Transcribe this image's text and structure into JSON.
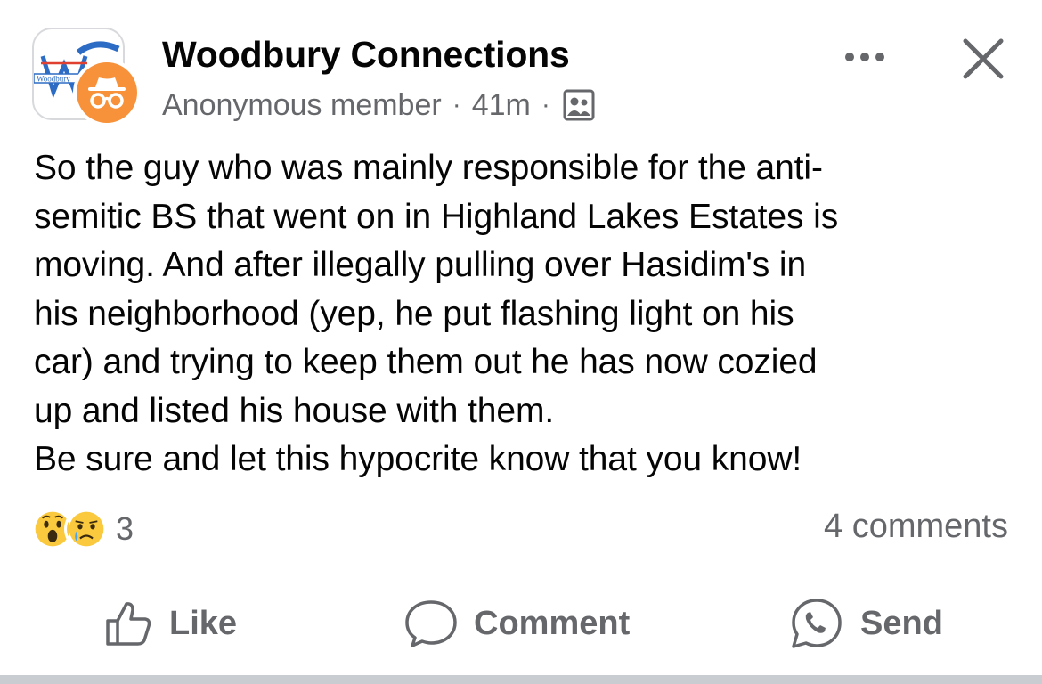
{
  "post": {
    "group_name": "Woodbury Connections",
    "group_logo_text": "Woodbury",
    "author": "Anonymous member",
    "separator": "·",
    "time": "41m",
    "audience_icon": "group-audience-icon",
    "body": "So the guy who was mainly responsible for the anti-\nsemitic BS that went on in Highland Lakes Estates is\nmoving. And after illegally pulling over Hasidim's in\nhis neighborhood (yep, he put flashing light on his\ncar) and trying to keep them out he has now cozied\nup and listed his house with them.\nBe sure and let this hypocrite know that you know!",
    "reactions": {
      "icons": [
        "wow-reaction-icon",
        "sad-reaction-icon"
      ],
      "count": "3"
    },
    "comments_count": "4 comments"
  },
  "actions": {
    "like": "Like",
    "comment": "Comment",
    "send": "Send"
  },
  "colors": {
    "text": "#050505",
    "secondary": "#65676b",
    "anon_badge": "#f7923a",
    "reaction_yellow": "#fbc93d",
    "divider": "#c9ccd1"
  }
}
